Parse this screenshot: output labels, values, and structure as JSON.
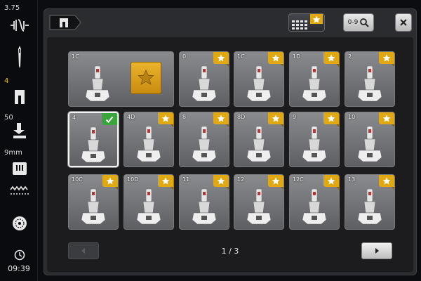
{
  "sidebar": {
    "stitch_width": "3.75",
    "presser_foot_label": "4",
    "presser_pressure": "50",
    "needle_size": "9mm",
    "time": "09:39"
  },
  "header": {
    "search_label": "0-9"
  },
  "tiles": [
    {
      "label": "1C",
      "wide": true
    },
    {
      "label": "0",
      "wide": false
    },
    {
      "label": "1C",
      "wide": false
    },
    {
      "label": "1D",
      "wide": false
    },
    {
      "label": "2",
      "wide": false
    },
    {
      "label": "4",
      "wide": false,
      "selected": true
    },
    {
      "label": "4D",
      "wide": false
    },
    {
      "label": "8",
      "wide": false
    },
    {
      "label": "8D",
      "wide": false
    },
    {
      "label": "9",
      "wide": false
    },
    {
      "label": "10",
      "wide": false
    },
    {
      "label": "10C",
      "wide": false
    },
    {
      "label": "10D",
      "wide": false
    },
    {
      "label": "11",
      "wide": false
    },
    {
      "label": "12",
      "wide": false
    },
    {
      "label": "12C",
      "wide": false
    },
    {
      "label": "13",
      "wide": false
    }
  ],
  "pager": {
    "text": "1 / 3"
  },
  "colors": {
    "accent_gold": "#e0a912",
    "selected_green": "#3aa53a"
  }
}
